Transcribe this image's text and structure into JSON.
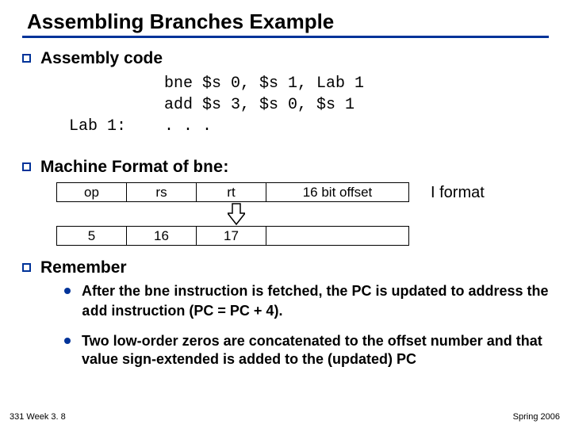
{
  "title": "Assembling Branches Example",
  "sections": {
    "assembly": {
      "heading": "Assembly code",
      "code": "          bne $s 0, $s 1, Lab 1\n          add $s 3, $s 0, $s 1\nLab 1:    . . ."
    },
    "machine": {
      "heading_prefix": "Machine Format of ",
      "heading_mono": "bne",
      "heading_suffix": ":",
      "iformat_label": "I  format",
      "table1": {
        "c0": "op",
        "c1": "rs",
        "c2": "rt",
        "c3": "16 bit offset"
      },
      "table2": {
        "c0": "5",
        "c1": "16",
        "c2": "17",
        "c3": ""
      }
    },
    "remember": {
      "heading": "Remember",
      "items": [
        {
          "pre": "After the ",
          "m1": "bne",
          "mid": " instruction is fetched, the PC is updated to address the ",
          "m2": "add",
          "post": " instruction (PC = PC + 4)."
        },
        {
          "text": "Two low-order zeros are concatenated to the offset number and that value sign-extended is added to the (updated) PC"
        }
      ]
    }
  },
  "footer": {
    "left": "331 Week 3. 8",
    "right": "Spring 2006"
  }
}
